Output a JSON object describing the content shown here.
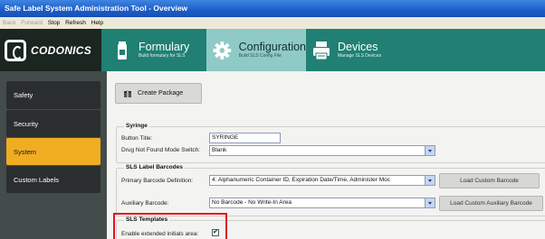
{
  "window": {
    "title": "Safe Label System Administration Tool - Overview"
  },
  "menu": {
    "items": [
      {
        "label": "Back",
        "enabled": false
      },
      {
        "label": "Forward",
        "enabled": false
      },
      {
        "label": "Stop",
        "enabled": true
      },
      {
        "label": "Refresh",
        "enabled": true
      },
      {
        "label": "Help",
        "enabled": true
      }
    ]
  },
  "brand": {
    "name": "CODONICS",
    "logo_icon": "codonics-logo-icon"
  },
  "nav": {
    "tabs": [
      {
        "label": "Formulary",
        "sub": "Build formulary for SLS",
        "icon": "vial-icon",
        "active": false
      },
      {
        "label": "Configuration",
        "sub": "Build SLS Config File",
        "icon": "gear-icon",
        "active": true
      },
      {
        "label": "Devices",
        "sub": "Manage SLS Devices",
        "icon": "printer-icon",
        "active": false
      }
    ]
  },
  "sidebar": {
    "items": [
      {
        "label": "Safety",
        "active": false
      },
      {
        "label": "Security",
        "active": false
      },
      {
        "label": "System",
        "active": true
      },
      {
        "label": "Custom Labels",
        "active": false
      }
    ]
  },
  "toolbar": {
    "create_package_label": "Create Package",
    "create_package_icon": "package-icon"
  },
  "syringe": {
    "title": "Syringe",
    "button_title_label": "Button Title:",
    "button_title_value": "SYRINGE",
    "drug_not_found_label": "Drug Not Found Mode Switch:",
    "drug_not_found_value": "Blank"
  },
  "barcodes": {
    "title": "SLS Label Barcodes",
    "primary_label": "Primary Barcode Definition:",
    "primary_value": "4: Alphanumeric Container ID, Expiration Date/Time, Administer Moc",
    "load_custom_label": "Load Custom Barcode",
    "auxiliary_label": "Auxiliary Barcode:",
    "auxiliary_value": "No Barcode - No Write-In Area",
    "load_custom_aux_label": "Load Custom Auxiliary Barcode"
  },
  "templates": {
    "title": "SLS Templates",
    "extended_initials_label": "Enable extended initials area:",
    "extended_initials_checked": true,
    "check_glyph": "✔"
  },
  "colors": {
    "title_bar": "#1c5cc8",
    "nav_band": "#1f8073",
    "nav_active": "#8fcac6",
    "sidebar_bg": "#444c4b",
    "sidebar_active": "#f0ad22",
    "highlight_box": "#e2151f"
  }
}
